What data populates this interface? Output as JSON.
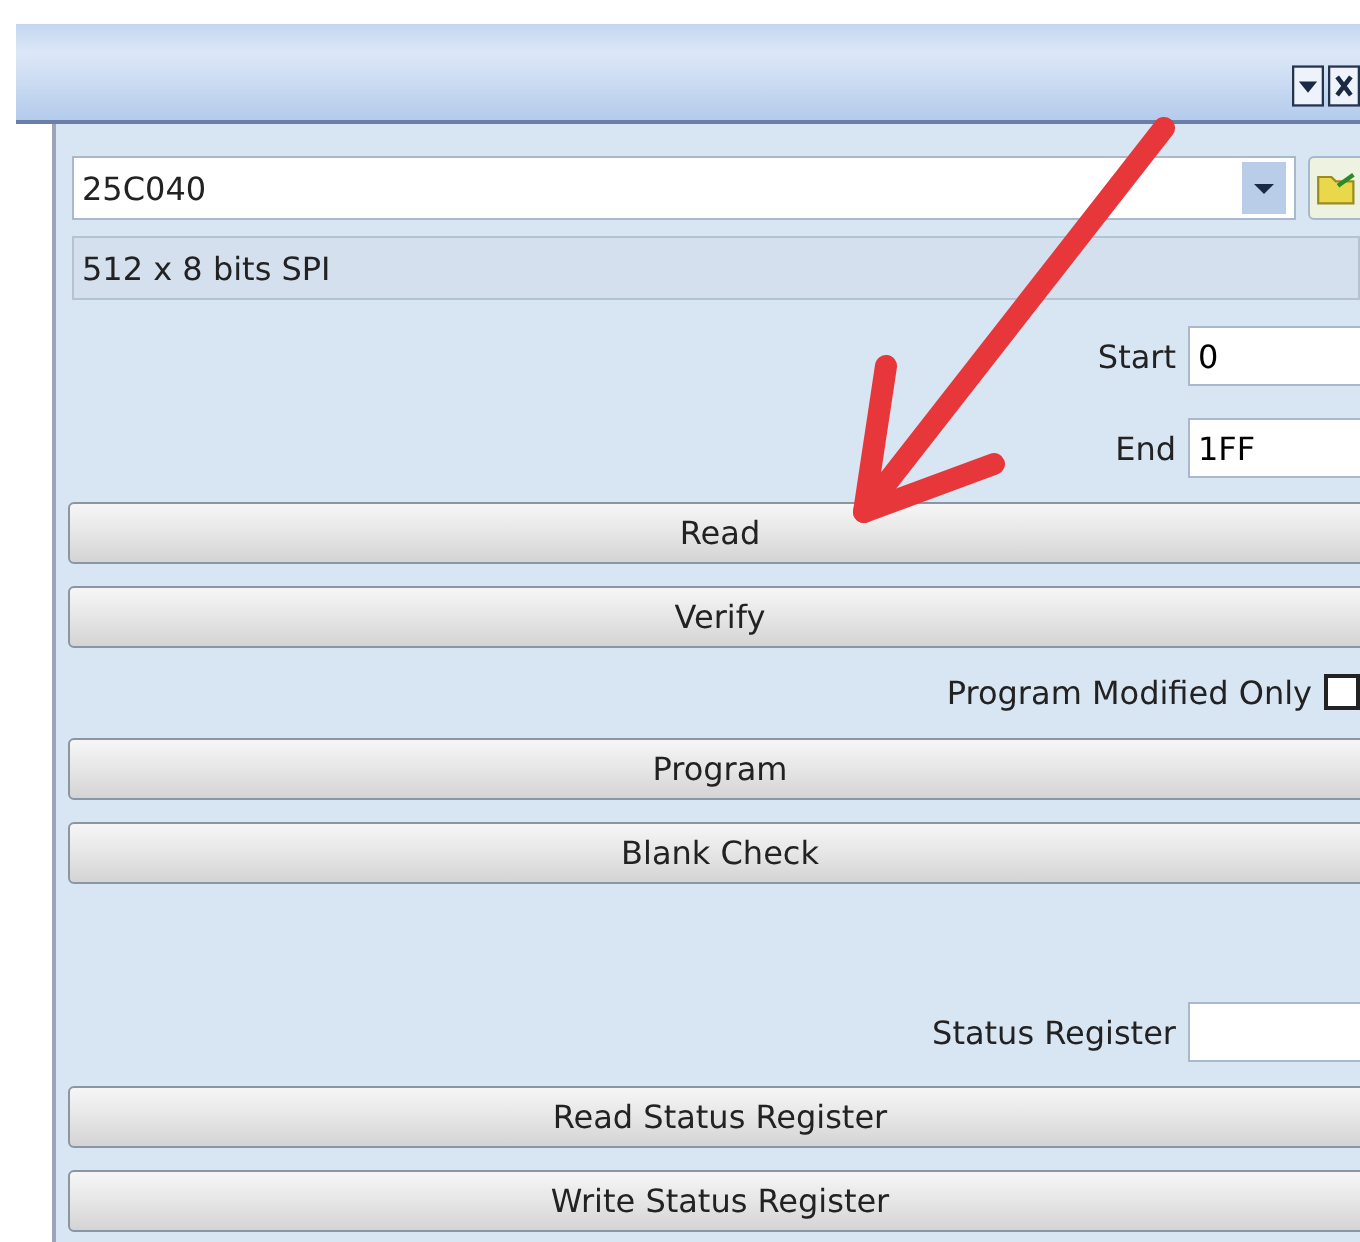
{
  "device_combo": {
    "value": "25C040"
  },
  "device_info": "512 x 8 bits SPI",
  "items": [
    {
      "kind": "field",
      "label": "Start",
      "value": "0"
    },
    {
      "kind": "field",
      "label": "End",
      "value": "1FF"
    },
    {
      "kind": "button",
      "label": "Read"
    },
    {
      "kind": "button",
      "label": "Verify"
    },
    {
      "kind": "checkbox",
      "label": "Program Modified Only",
      "checked": false
    },
    {
      "kind": "button",
      "label": "Program"
    },
    {
      "kind": "button",
      "label": "Blank Check"
    },
    {
      "kind": "spacer"
    },
    {
      "kind": "field",
      "label": "Status Register",
      "value": ""
    },
    {
      "kind": "button",
      "label": "Read Status Register"
    },
    {
      "kind": "button",
      "label": "Write Status Register"
    }
  ]
}
